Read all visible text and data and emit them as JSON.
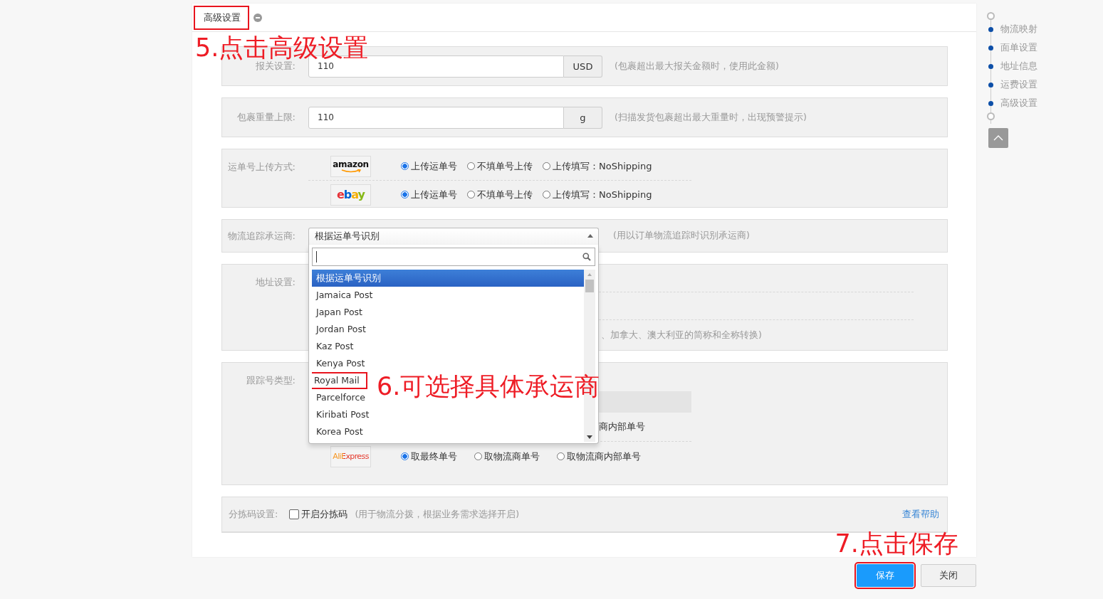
{
  "panel_title": {
    "text": "高级设置",
    "highlighted": true
  },
  "sections": [
    {
      "kind": "input",
      "label": "报关设置:",
      "value": "110",
      "unit": "USD",
      "hint": "(包裹超出最大报关金额时，使用此金额)"
    },
    {
      "kind": "input",
      "label": "包裹重量上限:",
      "value": "110",
      "unit": "g",
      "hint": "(扫描发货包裹超出最大重量时，出现预警提示)"
    },
    {
      "kind": "platform_radios",
      "label": "运单号上传方式:",
      "rows": [
        {
          "logo": "amazon",
          "kind": "amazon",
          "options": [
            {
              "label": "上传运单号",
              "selected": true
            },
            {
              "label": "不填单号上传",
              "selected": false
            },
            {
              "label": "上传填写：NoShipping",
              "selected": false
            }
          ]
        },
        {
          "logo": "ebay",
          "kind": "ebay",
          "options": [
            {
              "label": "上传运单号",
              "selected": true
            },
            {
              "label": "不填单号上传",
              "selected": false
            },
            {
              "label": "上传填写：NoShipping",
              "selected": false
            }
          ]
        }
      ]
    },
    {
      "kind": "select",
      "label": "物流追踪承运商:",
      "value": "根据运单号识别",
      "hint": "(用以订单物流追踪时识别承运商)",
      "dropdown": {
        "annotation": "6.可选择具体承运商",
        "options": [
          {
            "label": "根据运单号识别",
            "selected": true,
            "highlighted": false
          },
          {
            "label": "Jamaica Post",
            "selected": false,
            "highlighted": false
          },
          {
            "label": "Japan Post",
            "selected": false,
            "highlighted": false
          },
          {
            "label": "Jordan Post",
            "selected": false,
            "highlighted": false
          },
          {
            "label": "Kaz Post",
            "selected": false,
            "highlighted": false
          },
          {
            "label": "Kenya Post",
            "selected": false,
            "highlighted": false
          },
          {
            "label": "Royal Mail",
            "selected": false,
            "highlighted": true
          },
          {
            "label": "Parcelforce",
            "selected": false,
            "highlighted": false
          },
          {
            "label": "Kiribati Post",
            "selected": false,
            "highlighted": false
          },
          {
            "label": "Korea Post",
            "selected": false,
            "highlighted": false
          }
        ]
      }
    },
    {
      "kind": "address",
      "label": "地址设置:",
      "hint": "、加拿大、澳大利亚的简称和全称转换)"
    },
    {
      "kind": "tracking",
      "label": "跟踪号类型:",
      "partial_text": "商内部单号",
      "rows": [
        {
          "logo": "AliExpress",
          "kind": "aliexpress",
          "options": [
            {
              "label": "取最终单号",
              "selected": true
            },
            {
              "label": "取物流商单号",
              "selected": false
            },
            {
              "label": "取物流商内部单号",
              "selected": false
            }
          ]
        }
      ]
    },
    {
      "kind": "checkbox",
      "label": "分拣码设置:",
      "checkbox": {
        "label": "开启分拣码",
        "checked": false
      },
      "hint": "(用于物流分拨，根据业务需求选择开启)",
      "link": "查看帮助"
    }
  ],
  "annotations": {
    "title": "5.点击高级设置",
    "save": "7.点击保存"
  },
  "buttons": [
    {
      "label": "保存",
      "kind": "primary",
      "highlighted": true
    },
    {
      "label": "关闭",
      "kind": "default",
      "highlighted": false
    }
  ],
  "nav": [
    {
      "label": "物流映射"
    },
    {
      "label": "面单设置"
    },
    {
      "label": "地址信息"
    },
    {
      "label": "运费设置"
    },
    {
      "label": "高级设置"
    }
  ]
}
